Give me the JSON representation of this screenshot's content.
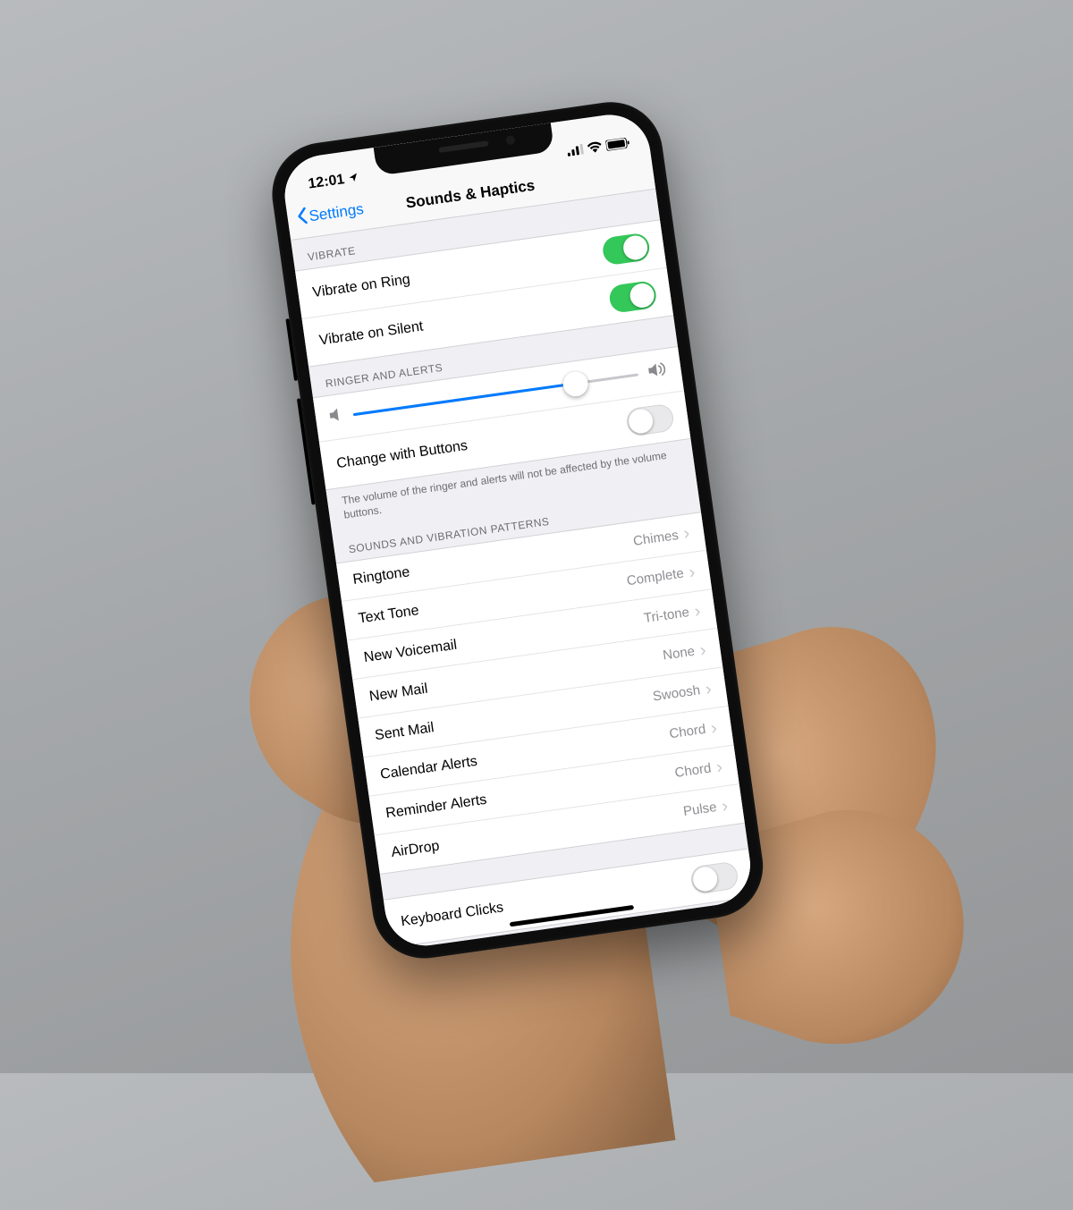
{
  "status": {
    "time": "12:01",
    "location_icon": "location-arrow"
  },
  "nav": {
    "back_label": "Settings",
    "title": "Sounds & Haptics"
  },
  "sections": {
    "vibrate": {
      "header": "VIBRATE",
      "rows": [
        {
          "label": "Vibrate on Ring",
          "toggle": true
        },
        {
          "label": "Vibrate on Silent",
          "toggle": true
        }
      ]
    },
    "ringer": {
      "header": "RINGER AND ALERTS",
      "slider_percent": 78,
      "change_with_buttons": {
        "label": "Change with Buttons",
        "toggle": false
      },
      "footer": "The volume of the ringer and alerts will not be affected by the volume buttons."
    },
    "patterns": {
      "header": "SOUNDS AND VIBRATION PATTERNS",
      "rows": [
        {
          "label": "Ringtone",
          "detail": "Chimes"
        },
        {
          "label": "Text Tone",
          "detail": "Complete"
        },
        {
          "label": "New Voicemail",
          "detail": "Tri-tone"
        },
        {
          "label": "New Mail",
          "detail": "None"
        },
        {
          "label": "Sent Mail",
          "detail": "Swoosh"
        },
        {
          "label": "Calendar Alerts",
          "detail": "Chord"
        },
        {
          "label": "Reminder Alerts",
          "detail": "Chord"
        },
        {
          "label": "AirDrop",
          "detail": "Pulse"
        }
      ]
    },
    "keyboard": {
      "rows": [
        {
          "label": "Keyboard Clicks",
          "toggle": false
        }
      ]
    }
  }
}
